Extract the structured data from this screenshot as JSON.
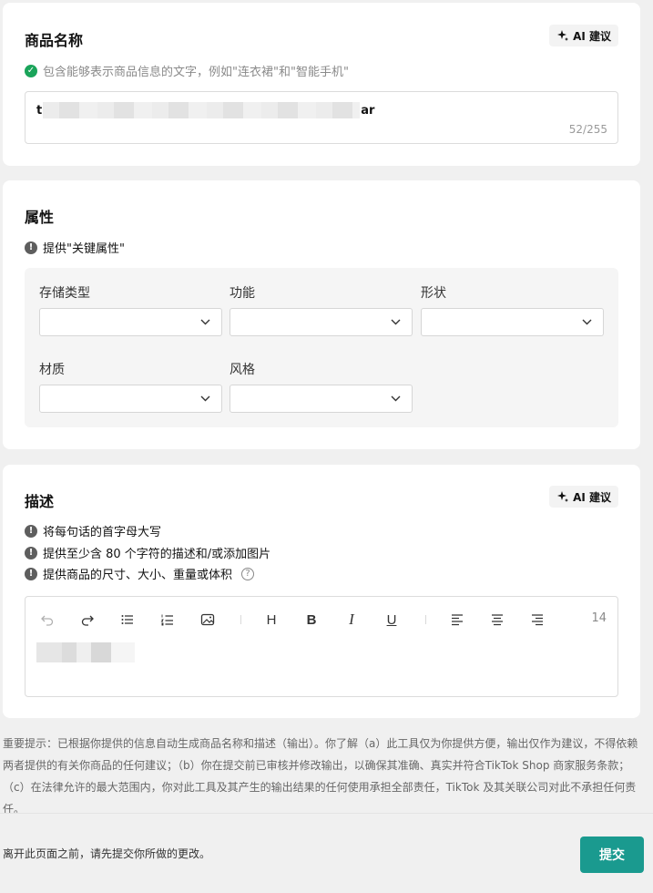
{
  "product_name": {
    "title": "商品名称",
    "ai_label": "AI 建议",
    "hint": "包含能够表示商品信息的文字，例如\"连衣裙\"和\"智能手机\"",
    "value_start": "t",
    "value_end": "ar",
    "counter": "52/255"
  },
  "attributes": {
    "title": "属性",
    "hint": "提供\"关键属性\"",
    "fields": [
      {
        "label": "存储类型",
        "value": ""
      },
      {
        "label": "功能",
        "value": ""
      },
      {
        "label": "形状",
        "value": ""
      },
      {
        "label": "材质",
        "value": ""
      },
      {
        "label": "风格",
        "value": ""
      }
    ]
  },
  "description": {
    "title": "描述",
    "ai_label": "AI 建议",
    "hints": [
      "将每句话的首字母大写",
      "提供至少含 80 个字符的描述和/或添加图片",
      "提供商品的尺寸、大小、重量或体积"
    ],
    "toolbar": {
      "heading": "H",
      "bold": "B",
      "italic": "I",
      "underline": "U"
    },
    "char_count": "14"
  },
  "disclaimer": "重要提示：已根据你提供的信息自动生成商品名称和描述（输出）。你了解（a）此工具仅为你提供方便，输出仅作为建议，不得依赖两者提供的有关你商品的任何建议；（b）你在提交前已审核并修改输出，以确保其准确、真实并符合TikTok Shop 商家服务条款；（c）在法律允许的最大范围内，你对此工具及其产生的输出结果的任何使用承担全部责任，TikTok 及其关联公司对此不承担任何责任。",
  "footer": {
    "note": "离开此页面之前，请先提交你所做的更改。",
    "submit_label": "提交"
  },
  "colors": {
    "accent": "#1a9a8f",
    "success": "#1aa45a",
    "warn": "#5e5e5e"
  }
}
